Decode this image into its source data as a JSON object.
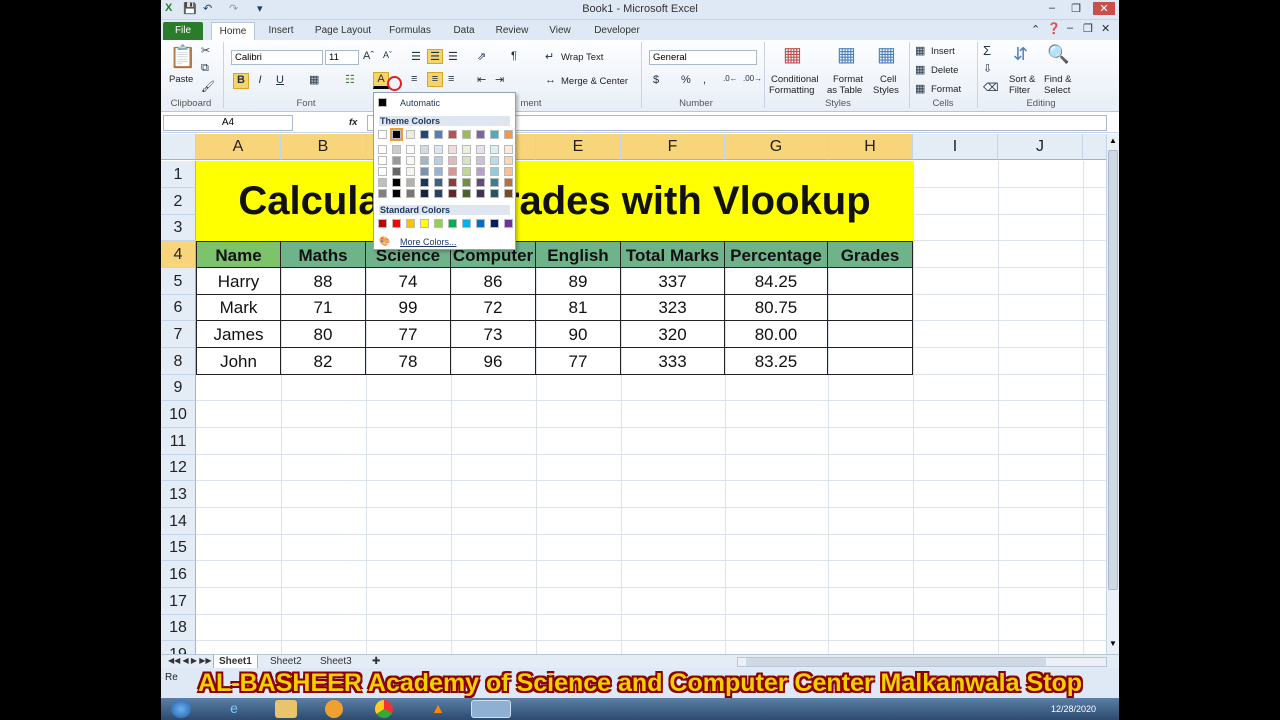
{
  "window": {
    "title": "Book1  -  Microsoft Excel"
  },
  "tabs": [
    "File",
    "Home",
    "Insert",
    "Page Layout",
    "Formulas",
    "Data",
    "Review",
    "View",
    "Developer"
  ],
  "ribbon": {
    "clipboard": {
      "paste": "Paste",
      "label": "Clipboard"
    },
    "font": {
      "name": "Calibri",
      "size": "11",
      "label": "Font",
      "bold": "B",
      "italic": "I",
      "underline": "U"
    },
    "alignment": {
      "wrap_text": "Wrap Text",
      "merge_center": "Merge & Center",
      "label_fragment": "ment"
    },
    "number": {
      "format": "General",
      "label": "Number"
    },
    "styles": {
      "conditional": "Conditional",
      "formatting": "Formatting",
      "format": "Format",
      "as_table": "as Table",
      "cell": "Cell",
      "cell_styles": "Styles",
      "label": "Styles"
    },
    "cells": {
      "insert": "Insert",
      "delete": "Delete",
      "format": "Format",
      "label": "Cells"
    },
    "editing": {
      "sort": "Sort &",
      "filter": "Filter",
      "find": "Find &",
      "select": "Select",
      "label": "Editing"
    }
  },
  "formula_bar": {
    "name_box": "A4",
    "fx": "fx"
  },
  "color_menu": {
    "automatic": "Automatic",
    "theme_colors": "Theme Colors",
    "standard_colors": "Standard Colors",
    "more_colors": "More Colors...",
    "theme_top": [
      "#ffffff",
      "#000000",
      "#eeece1",
      "#1f497d",
      "#4f81bd",
      "#c0504d",
      "#9bbb59",
      "#8064a2",
      "#4bacc6",
      "#f79646"
    ],
    "standard": [
      "#c00000",
      "#ff0000",
      "#ffc000",
      "#ffff00",
      "#92d050",
      "#00b050",
      "#00b0f0",
      "#0070c0",
      "#002060",
      "#7030a0"
    ]
  },
  "columns": [
    "A",
    "B",
    "C",
    "D",
    "E",
    "F",
    "G",
    "H",
    "I",
    "J"
  ],
  "rows": [
    "1",
    "2",
    "3",
    "4",
    "5",
    "6",
    "7",
    "8",
    "9",
    "10",
    "11",
    "12",
    "13",
    "14",
    "15",
    "16",
    "17",
    "18",
    "19"
  ],
  "sheet": {
    "banner_visible_left": "Calculat",
    "banner_visible_right": "rades with Vlookup",
    "headers": [
      "Name",
      "Maths",
      "Science",
      "Computer",
      "English",
      "Total Marks",
      "Percentage",
      "Grades"
    ],
    "data": [
      [
        "Harry",
        "88",
        "74",
        "86",
        "89",
        "337",
        "84.25",
        ""
      ],
      [
        "Mark",
        "71",
        "99",
        "72",
        "81",
        "323",
        "80.75",
        ""
      ],
      [
        "James",
        "80",
        "77",
        "73",
        "90",
        "320",
        "80.00",
        ""
      ],
      [
        "John",
        "82",
        "78",
        "96",
        "77",
        "333",
        "83.25",
        ""
      ]
    ]
  },
  "sheet_tabs": [
    "Sheet1",
    "Sheet2",
    "Sheet3"
  ],
  "status": {
    "ready_fragment": "Re"
  },
  "overlay_text": "AL-BASHEER Academy of Science and Computer Center Malkanwala Stop",
  "taskbar": {
    "date": "12/28/2020"
  }
}
